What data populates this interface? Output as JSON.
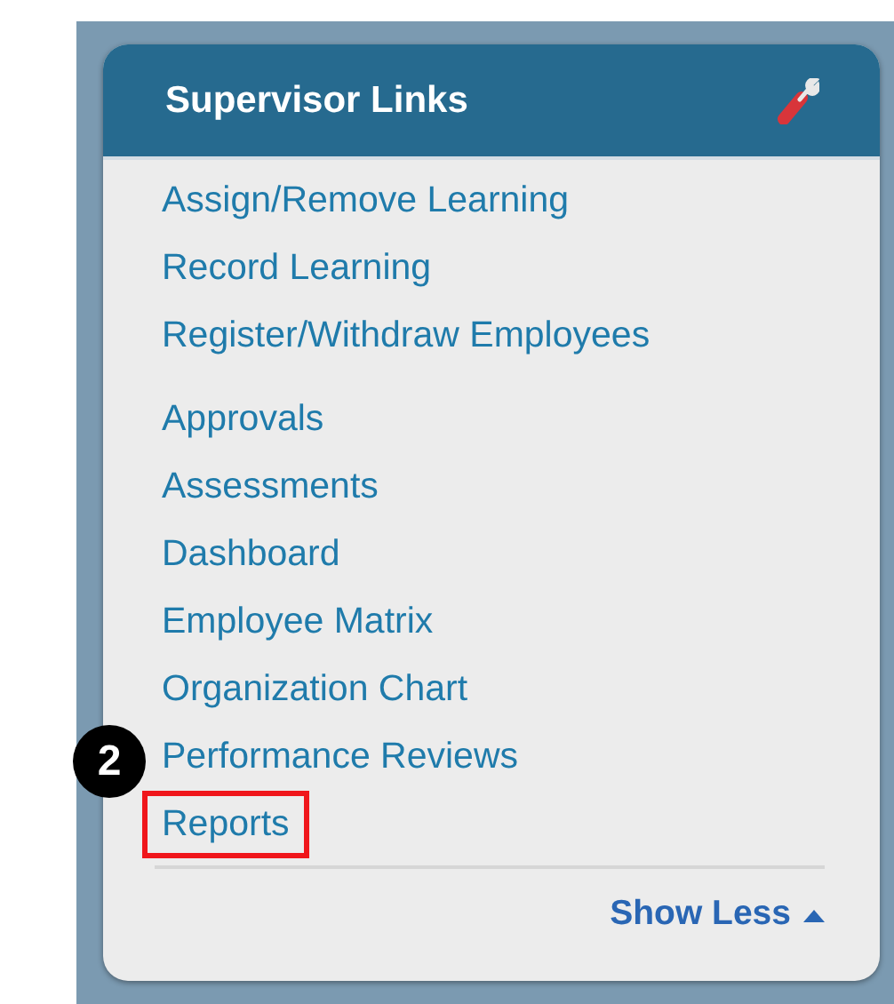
{
  "panel": {
    "title": "Supervisor Links"
  },
  "link_groups": [
    {
      "links": [
        {
          "label": "Assign/Remove Learning",
          "highlighted": false
        },
        {
          "label": "Record Learning",
          "highlighted": false
        },
        {
          "label": "Register/Withdraw Employees",
          "highlighted": false
        }
      ]
    },
    {
      "links": [
        {
          "label": "Approvals",
          "highlighted": false
        },
        {
          "label": "Assessments",
          "highlighted": false
        },
        {
          "label": "Dashboard",
          "highlighted": false
        },
        {
          "label": "Employee Matrix",
          "highlighted": false
        },
        {
          "label": "Organization Chart",
          "highlighted": false
        },
        {
          "label": "Performance Reviews",
          "highlighted": false
        },
        {
          "label": "Reports",
          "highlighted": true
        }
      ]
    }
  ],
  "callout": {
    "label": "2"
  },
  "toggle": {
    "label": "Show Less",
    "expanded": true
  }
}
